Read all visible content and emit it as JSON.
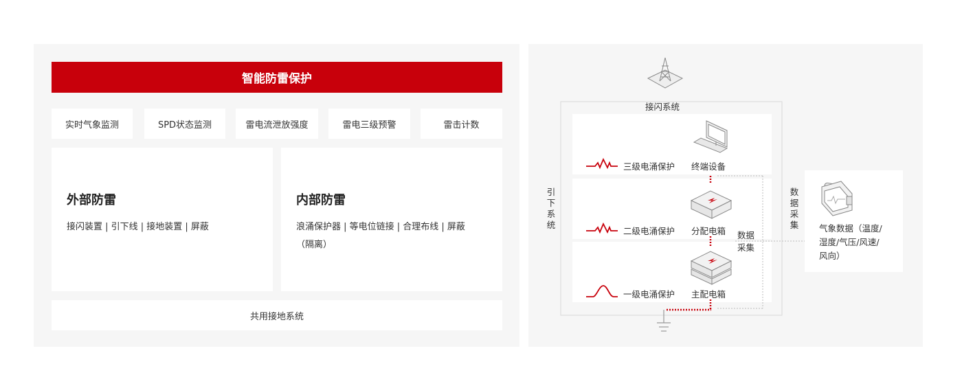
{
  "left": {
    "banner": "智能防雷保护",
    "tags": [
      "实时气象监测",
      "SPD状态监测",
      "雷电流泄放强度",
      "雷电三级预警",
      "雷击计数"
    ],
    "external": {
      "title": "外部防雷",
      "desc": "接闪装置 | 引下线 | 接地装置 | 屏蔽"
    },
    "internal": {
      "title": "内部防雷",
      "desc_line1": "浪涌保护器 | 等电位链接 | 合理布线 | 屏蔽",
      "desc_line2": "（隔离）"
    },
    "grounding": "共用接地系统"
  },
  "right": {
    "top_label": "接闪系统",
    "down_system": "引下系统",
    "data_collect_inner": [
      "数据",
      "采集"
    ],
    "data_collect_outer": "数据采集",
    "levels": [
      {
        "protect": "三级电涌保护",
        "device": "终端设备",
        "device_icon": "monitor-icon"
      },
      {
        "protect": "二级电涌保护",
        "device": "分配电箱",
        "device_icon": "box-icon"
      },
      {
        "protect": "一级电涌保护",
        "device": "主配电箱",
        "device_icon": "box-stack-icon"
      }
    ],
    "weather": {
      "line1": "气象数据（温度/",
      "line2": "湿度/气压/风速/",
      "line3": "风向）",
      "icon": "weather-station-icon"
    },
    "colors": {
      "red": "#c8000b",
      "line": "#cccccc"
    }
  }
}
